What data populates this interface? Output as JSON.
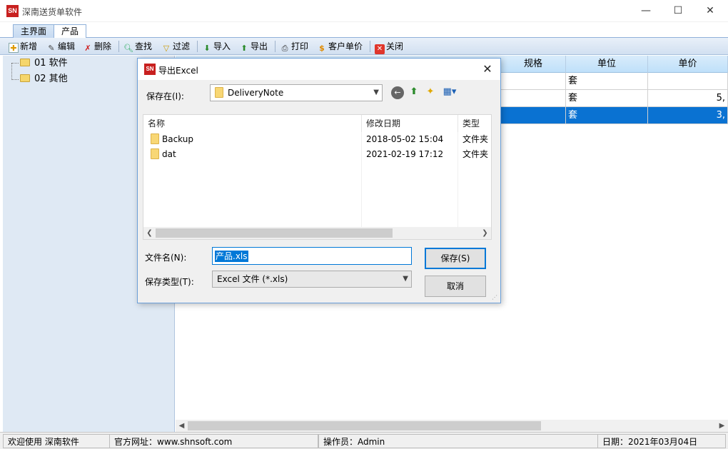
{
  "window": {
    "icon_text": "SN",
    "title": "深南送货单软件",
    "min": "—",
    "max": "☐",
    "close": "✕"
  },
  "tabs": [
    {
      "label": "主界面"
    },
    {
      "label": "产品"
    }
  ],
  "toolbar": {
    "new": "新增",
    "edit": "编辑",
    "delete": "删除",
    "find": "查找",
    "filter": "过滤",
    "import": "导入",
    "export": "导出",
    "print": "打印",
    "customer_price": "客户单价",
    "close": "关闭"
  },
  "tree": {
    "items": [
      {
        "label": "01  软件"
      },
      {
        "label": "02  其他"
      }
    ]
  },
  "grid": {
    "columns": [
      "规格",
      "单位",
      "单价"
    ],
    "rows": [
      {
        "spec": "",
        "unit": "套",
        "price": ""
      },
      {
        "spec": "",
        "unit": "套",
        "price": "5,"
      },
      {
        "spec": "",
        "unit": "套",
        "price": "3,"
      }
    ]
  },
  "status": {
    "welcome": "欢迎使用 深南软件",
    "website": "官方网址：www.shnsoft.com",
    "operator": "操作员：Admin",
    "date": "日期：2021年03月04日"
  },
  "dialog": {
    "icon_text": "SN",
    "title": "导出Excel",
    "save_in_label": "保存在(I):",
    "save_in_value": "DeliveryNote",
    "list_headers": [
      "名称",
      "修改日期",
      "类型"
    ],
    "files": [
      {
        "name": "Backup",
        "modified": "2018-05-02 15:04",
        "type": "文件夹"
      },
      {
        "name": "dat",
        "modified": "2021-02-19 17:12",
        "type": "文件夹"
      }
    ],
    "filename_label": "文件名(N):",
    "filename_value": "产品.xls",
    "filetype_label": "保存类型(T):",
    "filetype_value": "Excel 文件 (*.xls)",
    "save_button": "保存(S)",
    "cancel_button": "取消"
  },
  "colors": {
    "selection": "#0a72d2",
    "accent": "#0078d7",
    "brand_red": "#c8201f"
  }
}
